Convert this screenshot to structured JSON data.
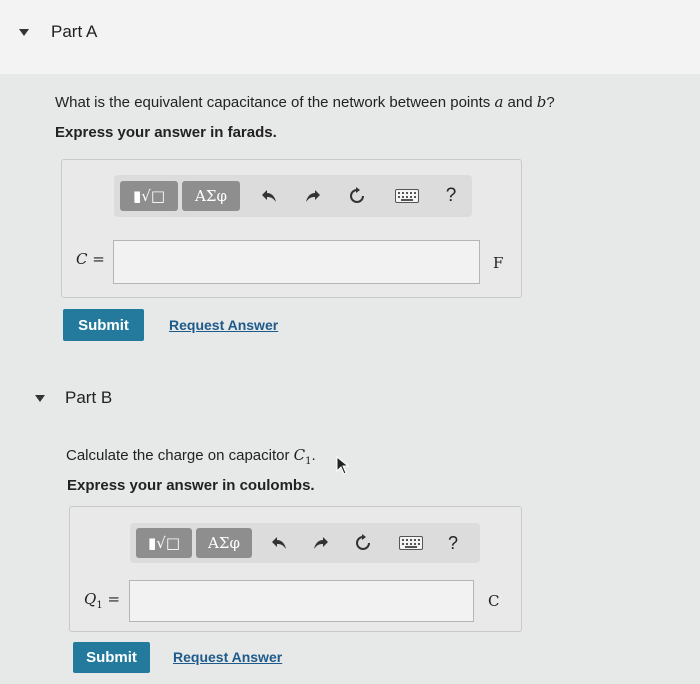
{
  "partA": {
    "header": "Part A",
    "question_prefix": "What is the equivalent capacitance of the network between points ",
    "point_a": "a",
    "question_and": " and ",
    "point_b": "b",
    "question_suffix": "?",
    "instruction": "Express your answer in farads.",
    "toolbar": {
      "template_label": "▮√□",
      "greek_label": "ΑΣφ",
      "help_label": "?"
    },
    "lhs_var": "C",
    "lhs_eq": " =",
    "input_value": "",
    "unit": "F",
    "submit_label": "Submit",
    "request_label": "Request Answer"
  },
  "partB": {
    "header": "Part B",
    "question_prefix": "Calculate the charge on capacitor ",
    "capacitor": "C",
    "capacitor_sub": "1",
    "question_suffix": ".",
    "instruction": "Express your answer in coulombs.",
    "toolbar": {
      "template_label": "▮√□",
      "greek_label": "ΑΣφ",
      "help_label": "?"
    },
    "lhs_var": "Q",
    "lhs_sub": "1",
    "lhs_eq": " =",
    "input_value": "",
    "unit": "C",
    "submit_label": "Submit",
    "request_label": "Request Answer"
  },
  "icons": {
    "undo": "undo-icon",
    "redo": "redo-icon",
    "reset": "reset-icon",
    "keyboard": "keyboard-icon",
    "help": "help-icon",
    "caret": "caret-down-icon",
    "cursor": "mouse-cursor-icon"
  },
  "colors": {
    "submit": "#247a9c",
    "link": "#1e5a8a",
    "toolbar_button": "#8e8e8e"
  }
}
